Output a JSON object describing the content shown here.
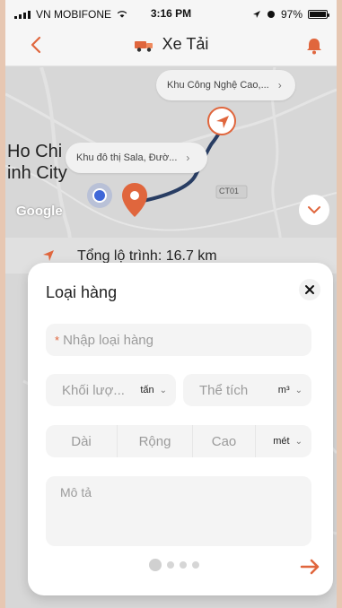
{
  "status_bar": {
    "carrier": "VN MOBIFONE",
    "time": "3:16 PM",
    "battery": "97%"
  },
  "header": {
    "title": "Xe Tải",
    "back_icon": "chevron-left-icon",
    "bell_icon": "bell-icon",
    "truck_icon": "truck-icon"
  },
  "map": {
    "callout_top": "Khu Công Nghệ Cao,...",
    "callout_left": "Khu đô thị Sala, Đườ...",
    "city_line1": "Ho Chi",
    "city_line2": "inh City",
    "google": "Google",
    "road_label": "CT01",
    "collapse_icon": "chevron-down-icon"
  },
  "route_summary": {
    "text": "Tổng lộ trình: 16.7 km",
    "icon": "navigation-arrow-icon"
  },
  "modal": {
    "title": "Loại hàng",
    "close_icon": "close-icon",
    "cargo_type_placeholder": "Nhập loại hàng",
    "weight_placeholder": "Khối lượ...",
    "weight_unit": "tấn",
    "volume_placeholder": "Thể tích",
    "volume_unit": "m³",
    "length_placeholder": "Dài",
    "width_placeholder": "Rộng",
    "height_placeholder": "Cao",
    "dimension_unit": "mét",
    "description_placeholder": "Mô tả",
    "next_icon": "arrow-right-icon"
  },
  "colors": {
    "accent": "#e0663d",
    "route": "#283d63",
    "text": "#222222",
    "placeholder": "#9b9b9b"
  }
}
